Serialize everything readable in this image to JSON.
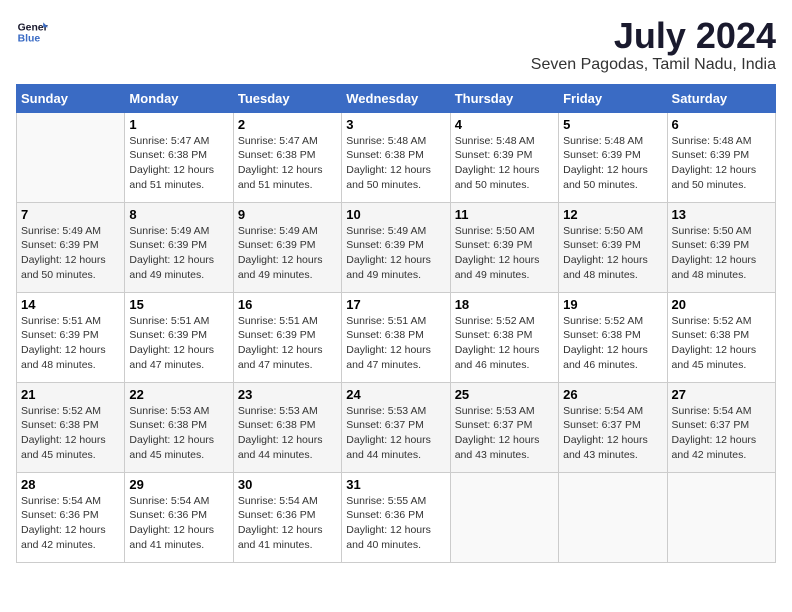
{
  "header": {
    "logo_line1": "General",
    "logo_line2": "Blue",
    "title": "July 2024",
    "subtitle": "Seven Pagodas, Tamil Nadu, India"
  },
  "calendar": {
    "weekdays": [
      "Sunday",
      "Monday",
      "Tuesday",
      "Wednesday",
      "Thursday",
      "Friday",
      "Saturday"
    ],
    "weeks": [
      [
        {
          "day": "",
          "info": ""
        },
        {
          "day": "1",
          "info": "Sunrise: 5:47 AM\nSunset: 6:38 PM\nDaylight: 12 hours\nand 51 minutes."
        },
        {
          "day": "2",
          "info": "Sunrise: 5:47 AM\nSunset: 6:38 PM\nDaylight: 12 hours\nand 51 minutes."
        },
        {
          "day": "3",
          "info": "Sunrise: 5:48 AM\nSunset: 6:38 PM\nDaylight: 12 hours\nand 50 minutes."
        },
        {
          "day": "4",
          "info": "Sunrise: 5:48 AM\nSunset: 6:39 PM\nDaylight: 12 hours\nand 50 minutes."
        },
        {
          "day": "5",
          "info": "Sunrise: 5:48 AM\nSunset: 6:39 PM\nDaylight: 12 hours\nand 50 minutes."
        },
        {
          "day": "6",
          "info": "Sunrise: 5:48 AM\nSunset: 6:39 PM\nDaylight: 12 hours\nand 50 minutes."
        }
      ],
      [
        {
          "day": "7",
          "info": "Sunrise: 5:49 AM\nSunset: 6:39 PM\nDaylight: 12 hours\nand 50 minutes."
        },
        {
          "day": "8",
          "info": "Sunrise: 5:49 AM\nSunset: 6:39 PM\nDaylight: 12 hours\nand 49 minutes."
        },
        {
          "day": "9",
          "info": "Sunrise: 5:49 AM\nSunset: 6:39 PM\nDaylight: 12 hours\nand 49 minutes."
        },
        {
          "day": "10",
          "info": "Sunrise: 5:49 AM\nSunset: 6:39 PM\nDaylight: 12 hours\nand 49 minutes."
        },
        {
          "day": "11",
          "info": "Sunrise: 5:50 AM\nSunset: 6:39 PM\nDaylight: 12 hours\nand 49 minutes."
        },
        {
          "day": "12",
          "info": "Sunrise: 5:50 AM\nSunset: 6:39 PM\nDaylight: 12 hours\nand 48 minutes."
        },
        {
          "day": "13",
          "info": "Sunrise: 5:50 AM\nSunset: 6:39 PM\nDaylight: 12 hours\nand 48 minutes."
        }
      ],
      [
        {
          "day": "14",
          "info": "Sunrise: 5:51 AM\nSunset: 6:39 PM\nDaylight: 12 hours\nand 48 minutes."
        },
        {
          "day": "15",
          "info": "Sunrise: 5:51 AM\nSunset: 6:39 PM\nDaylight: 12 hours\nand 47 minutes."
        },
        {
          "day": "16",
          "info": "Sunrise: 5:51 AM\nSunset: 6:39 PM\nDaylight: 12 hours\nand 47 minutes."
        },
        {
          "day": "17",
          "info": "Sunrise: 5:51 AM\nSunset: 6:38 PM\nDaylight: 12 hours\nand 47 minutes."
        },
        {
          "day": "18",
          "info": "Sunrise: 5:52 AM\nSunset: 6:38 PM\nDaylight: 12 hours\nand 46 minutes."
        },
        {
          "day": "19",
          "info": "Sunrise: 5:52 AM\nSunset: 6:38 PM\nDaylight: 12 hours\nand 46 minutes."
        },
        {
          "day": "20",
          "info": "Sunrise: 5:52 AM\nSunset: 6:38 PM\nDaylight: 12 hours\nand 45 minutes."
        }
      ],
      [
        {
          "day": "21",
          "info": "Sunrise: 5:52 AM\nSunset: 6:38 PM\nDaylight: 12 hours\nand 45 minutes."
        },
        {
          "day": "22",
          "info": "Sunrise: 5:53 AM\nSunset: 6:38 PM\nDaylight: 12 hours\nand 45 minutes."
        },
        {
          "day": "23",
          "info": "Sunrise: 5:53 AM\nSunset: 6:38 PM\nDaylight: 12 hours\nand 44 minutes."
        },
        {
          "day": "24",
          "info": "Sunrise: 5:53 AM\nSunset: 6:37 PM\nDaylight: 12 hours\nand 44 minutes."
        },
        {
          "day": "25",
          "info": "Sunrise: 5:53 AM\nSunset: 6:37 PM\nDaylight: 12 hours\nand 43 minutes."
        },
        {
          "day": "26",
          "info": "Sunrise: 5:54 AM\nSunset: 6:37 PM\nDaylight: 12 hours\nand 43 minutes."
        },
        {
          "day": "27",
          "info": "Sunrise: 5:54 AM\nSunset: 6:37 PM\nDaylight: 12 hours\nand 42 minutes."
        }
      ],
      [
        {
          "day": "28",
          "info": "Sunrise: 5:54 AM\nSunset: 6:36 PM\nDaylight: 12 hours\nand 42 minutes."
        },
        {
          "day": "29",
          "info": "Sunrise: 5:54 AM\nSunset: 6:36 PM\nDaylight: 12 hours\nand 41 minutes."
        },
        {
          "day": "30",
          "info": "Sunrise: 5:54 AM\nSunset: 6:36 PM\nDaylight: 12 hours\nand 41 minutes."
        },
        {
          "day": "31",
          "info": "Sunrise: 5:55 AM\nSunset: 6:36 PM\nDaylight: 12 hours\nand 40 minutes."
        },
        {
          "day": "",
          "info": ""
        },
        {
          "day": "",
          "info": ""
        },
        {
          "day": "",
          "info": ""
        }
      ]
    ]
  }
}
